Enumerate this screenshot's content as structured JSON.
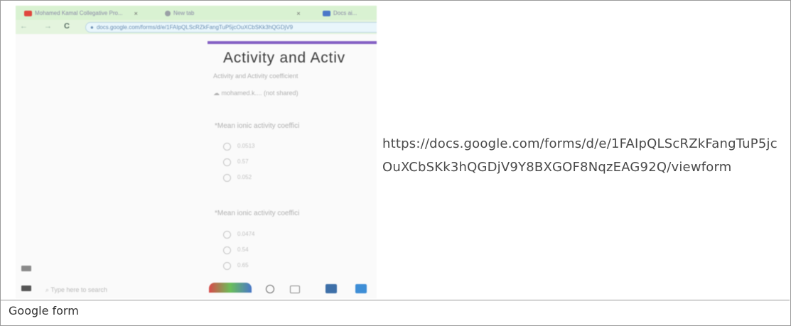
{
  "caption": "Google form",
  "form_url": "https://docs.google.com/forms/d/e/1FAIpQLScRZkFangTuP5jcOuXCbSKk3hQGDjV9Y8BXGOF8NqzEAG92Q/viewform",
  "embedded_screenshot": {
    "tabs": [
      {
        "label": "Mohamed Kamal Collegative Pro...",
        "close": "×",
        "favicon_color": "#e0463c"
      },
      {
        "label": "New tab",
        "close": "×",
        "favicon_color": "#9aa0a6"
      },
      {
        "label": "Docs ai...",
        "close": "",
        "favicon_color": "#4a78c8"
      }
    ],
    "nav": {
      "back": "←",
      "forward": "→",
      "reload": "C"
    },
    "address": "docs.google.com/forms/d/e/1FAIpQLScRZkFangTuP5jcOuXCbSKk3hQGDjV9",
    "form": {
      "title": "Activity and Activ",
      "subtitle": "Activity and Activity coefficient",
      "account_line": "mohamed.k.... (not shared)",
      "q1": "*Mean ionic activity coeffici",
      "q1_options": [
        "0.0513",
        "0.57",
        "0.052"
      ],
      "q2": "*Mean ionic activity coeffici",
      "q2_options": [
        "0.0474",
        "0.54",
        "0.65"
      ]
    },
    "taskbar": {
      "search_placeholder": "Type here to search"
    },
    "colors": {
      "accent": "#673ab7",
      "tabstrip": "#d9f2d2"
    }
  }
}
